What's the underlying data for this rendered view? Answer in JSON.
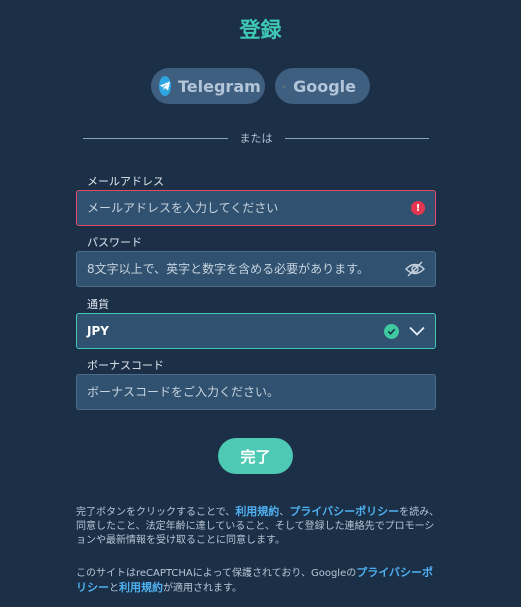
{
  "title": "登録",
  "social": {
    "telegram_label": "Telegram",
    "google_label": "Google"
  },
  "divider_text": "または",
  "email": {
    "label": "メールアドレス",
    "placeholder": "メールアドレスを入力してください"
  },
  "password": {
    "label": "パスワード",
    "placeholder": "8文字以上で、英字と数字を含める必要があります。"
  },
  "currency": {
    "label": "通貨",
    "value": "JPY"
  },
  "bonus": {
    "label": "ボーナスコード",
    "placeholder": "ボーナスコードをご入力ください。"
  },
  "submit_label": "完了",
  "terms": {
    "text1": "完了ボタンをクリックすることで、",
    "link_terms": "利用規約",
    "sep": "、",
    "link_privacy": "プライバシーポリシー",
    "text2": "を読み、同意したこと、法定年齢に達していること、そして登録した連絡先でプロモーションや最新情報を受け取ることに同意します。"
  },
  "recaptcha": {
    "text1": "このサイトはreCAPTCHAによって保護されており、Googleの",
    "link_privacy": "プライバシーポリシー",
    "text2": "と",
    "link_terms": "利用規約",
    "text3": "が適用されます。"
  },
  "colors": {
    "background": "#1b2f47",
    "accent": "#3fc9b4",
    "error": "#e04a64",
    "link": "#4fb0f0"
  }
}
